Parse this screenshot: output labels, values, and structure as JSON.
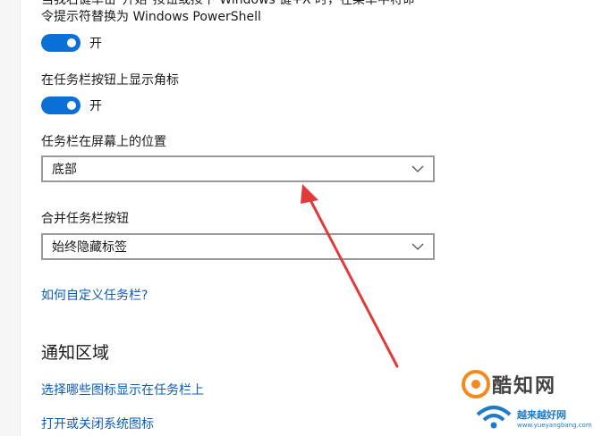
{
  "settings": {
    "winx": {
      "line1": "当我右键单击\"开始\"按钮或按下 Windows 键+X 时，在菜单中将命",
      "line2": "令提示符替换为 Windows PowerShell",
      "toggle_state": "开"
    },
    "badges": {
      "label": "在任务栏按钮上显示角标",
      "toggle_state": "开"
    },
    "position": {
      "label": "任务栏在屏幕上的位置",
      "selected": "底部"
    },
    "combine": {
      "label": "合并任务栏按钮",
      "selected": "始终隐藏标签"
    },
    "customize_link": "如何自定义任务栏?",
    "notification_area": {
      "title": "通知区域",
      "link1": "选择哪些图标显示在任务栏上",
      "link2": "打开或关闭系统图标"
    }
  },
  "watermark": {
    "brand": "酷知网",
    "sub": "越来越好网",
    "url": "www.yueyangbang.com"
  },
  "colors": {
    "toggle_on": "#0a6fd6",
    "link": "#0a5cb8",
    "annotation_arrow": "#e03a3a"
  }
}
